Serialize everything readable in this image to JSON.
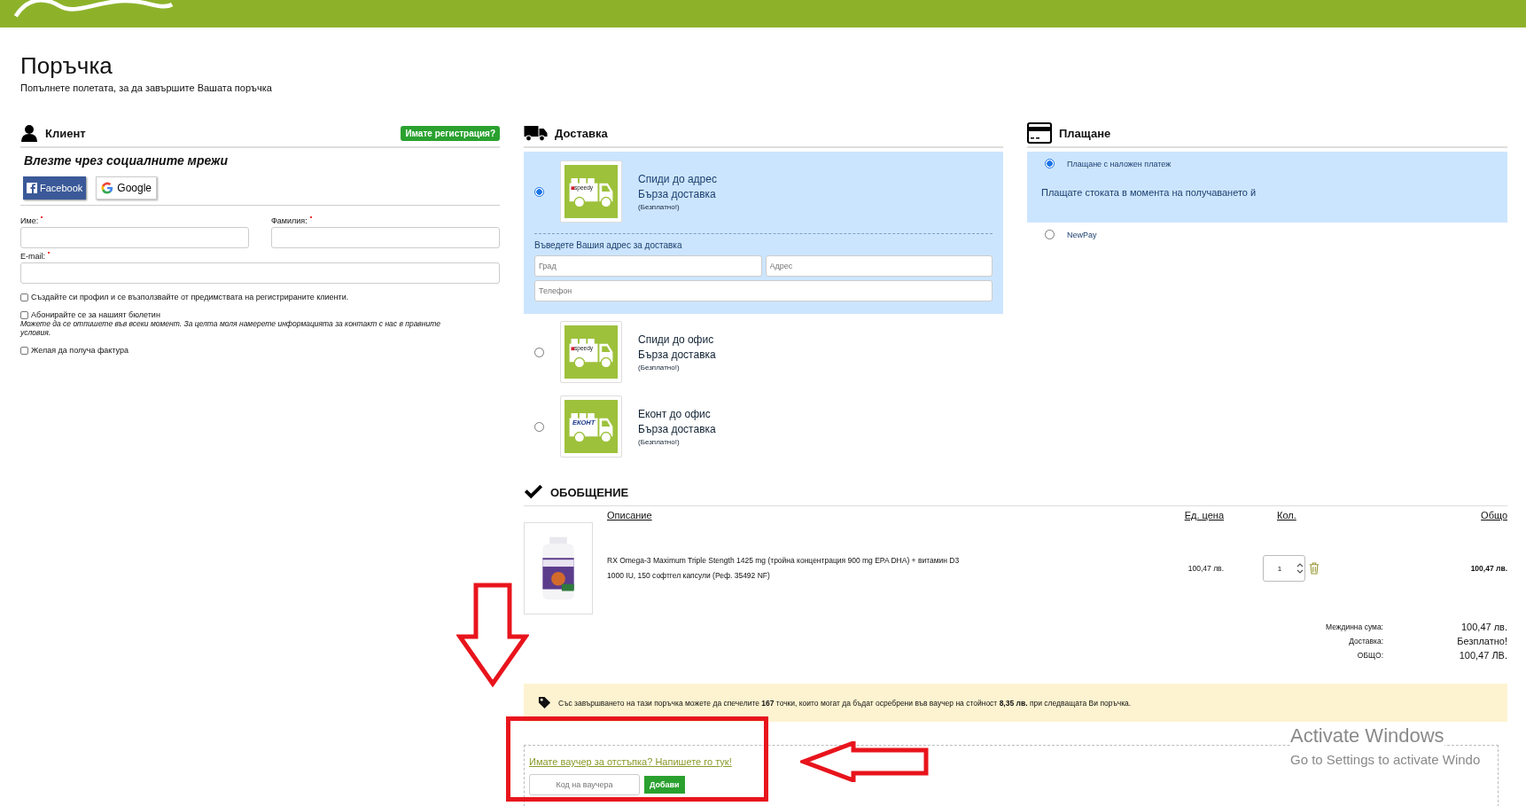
{
  "page": {
    "title": "Поръчка",
    "subtitle": "Попълнете полетата, за да завършите Вашата поръчка"
  },
  "client": {
    "title": "Клиент",
    "login_button": "Имате регистрация?",
    "social_title": "Влезте чрез социалните мрежи",
    "social_buttons": [
      {
        "kind": "facebook",
        "label": "Facebook"
      },
      {
        "kind": "google",
        "label": "Google"
      }
    ],
    "fields": [
      {
        "label": "Име:",
        "required": true,
        "wide": false
      },
      {
        "label": "Фамилия:",
        "required": true,
        "wide": false
      },
      {
        "label": "E-mail:",
        "required": true,
        "wide": true
      }
    ],
    "checkboxes": [
      {
        "label": "Създайте си профил и се възползвайте от предимствата на регистрираните клиенти.",
        "checked": false
      },
      {
        "label": "Абонирайте се за нашият бюлетин",
        "checked": false,
        "note": "Можете да се отпишете във всеки момент. За целта моля намерете информацията за контакт с нас в правните условия."
      },
      {
        "label": "Желая да получа фактура",
        "checked": false
      }
    ]
  },
  "delivery": {
    "title": "Доставка",
    "options": [
      {
        "name": "Спиди до адрес",
        "subtitle": "Бърза доставка",
        "price": "(Безплатно!)",
        "kind": "speedy",
        "logo_text": "speedy",
        "selected": true,
        "address_title": "Въведете Вашия адрес за доставка",
        "address_fields": [
          {
            "placeholder": "Град",
            "wide": false
          },
          {
            "placeholder": "Адрес",
            "wide": false
          },
          {
            "placeholder": "Телефон",
            "wide": true
          }
        ]
      },
      {
        "name": "Спиди до офис",
        "subtitle": "Бърза доставка",
        "price": "(Безплатно!)",
        "kind": "speedy",
        "logo_text": "speedy",
        "selected": false
      },
      {
        "name": "Еконт до офис",
        "subtitle": "Бърза доставка",
        "price": "(Безплатно!)",
        "kind": "econt",
        "logo_text": "ЕКОНТ",
        "selected": false
      }
    ]
  },
  "payment": {
    "title": "Плащане",
    "options": [
      {
        "label": "Плащане с наложен платеж",
        "selected": true,
        "description": "Плащате стоката в момента на получаването й"
      },
      {
        "label": "NewPay",
        "selected": false
      }
    ]
  },
  "summary": {
    "title": "ОБОБЩЕНИЕ",
    "columns": [
      "Описание",
      "Ед. цена",
      "Кол.",
      "Общо"
    ],
    "rows": [
      {
        "description": "RX Omega-3 Maximum Triple Stength 1425 mg (тройна концентрация 900 mg EPA DHA) + витамин D3 1000 IU, 150 софтгел капсули (Реф. 35492 NF)",
        "unit_price": "100,47 лв.",
        "quantity": "1",
        "total": "100,47 лв."
      }
    ],
    "totals": [
      {
        "label": "Междинна сума:",
        "value": "100,47 лв."
      },
      {
        "label": "Доставка:",
        "value": "Безплатно!"
      },
      {
        "label": "ОБЩО:",
        "value": "100,47 ЛВ."
      }
    ],
    "points_note": "Със завършването на тази поръчка можете да спечелите **167** точки, които могат да бъдат осребрени във ваучер на стойност **8,35 лв.** при следващата Ви поръчка.",
    "voucher": {
      "link": "Имате ваучер за отстъпка? Напишете го тук!",
      "placeholder": "Код на ваучера",
      "button": "Добави"
    }
  },
  "os_notice": {
    "title": "Activate Windows",
    "text": "Go to Settings to activate Windo"
  }
}
